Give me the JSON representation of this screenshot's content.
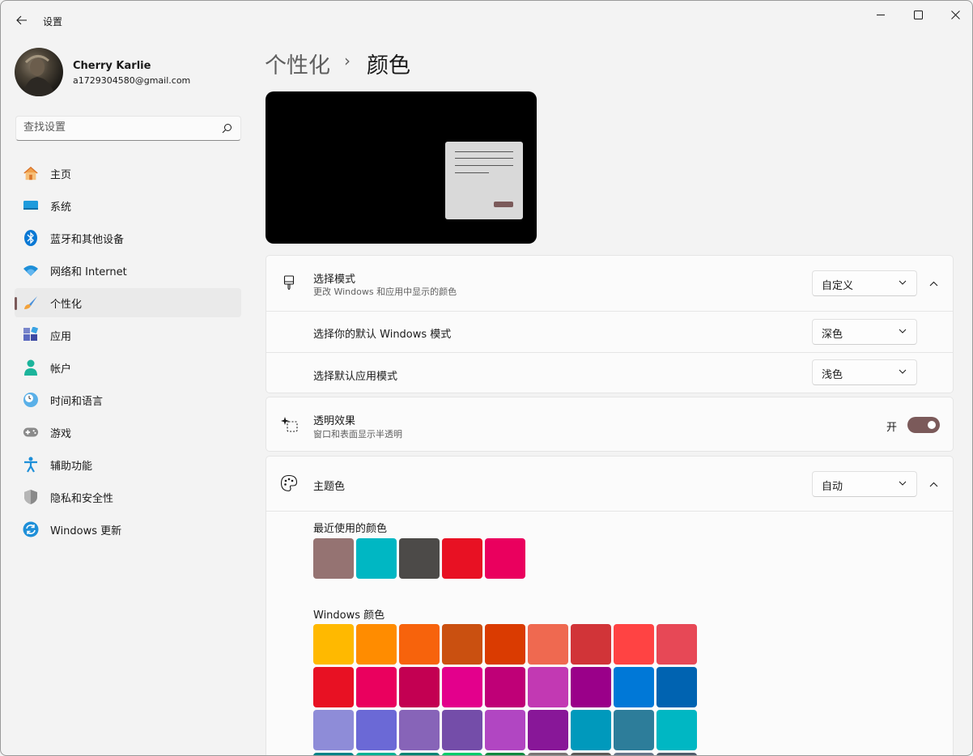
{
  "window": {
    "app_title": "设置",
    "controls": [
      "minimize-icon",
      "maximize-icon",
      "close-icon"
    ]
  },
  "user": {
    "name": "Cherry Karlie",
    "email": "a1729304580@gmail.com"
  },
  "search": {
    "placeholder": "查找设置"
  },
  "sidebar": {
    "items": [
      {
        "label": "主页",
        "icon": "home-icon"
      },
      {
        "label": "系统",
        "icon": "system-icon"
      },
      {
        "label": "蓝牙和其他设备",
        "icon": "bluetooth-icon"
      },
      {
        "label": "网络和 Internet",
        "icon": "wifi-icon"
      },
      {
        "label": "个性化",
        "icon": "brush-icon",
        "active": true
      },
      {
        "label": "应用",
        "icon": "apps-icon"
      },
      {
        "label": "帐户",
        "icon": "account-icon"
      },
      {
        "label": "时间和语言",
        "icon": "time-language-icon"
      },
      {
        "label": "游戏",
        "icon": "gamepad-icon"
      },
      {
        "label": "辅助功能",
        "icon": "accessibility-icon"
      },
      {
        "label": "隐私和安全性",
        "icon": "shield-icon"
      },
      {
        "label": "Windows 更新",
        "icon": "update-icon"
      }
    ]
  },
  "breadcrumb": {
    "parent": "个性化",
    "separator": "›",
    "current": "颜色"
  },
  "mode_card": {
    "title": "选择模式",
    "subtitle": "更改 Windows 和应用中显示的颜色",
    "value": "自定义",
    "windows_mode": {
      "label": "选择你的默认 Windows 模式",
      "value": "深色"
    },
    "app_mode": {
      "label": "选择默认应用模式",
      "value": "浅色"
    }
  },
  "transparency": {
    "title": "透明效果",
    "subtitle": "窗口和表面显示半透明",
    "state_label": "开",
    "on": true
  },
  "accent": {
    "title": "主题色",
    "value": "自动",
    "recent_label": "最近使用的颜色",
    "recent_colors": [
      "#957372",
      "#00b7c3",
      "#4c4a48",
      "#e81123",
      "#ea005e"
    ],
    "windows_label": "Windows 颜色",
    "windows_colors": [
      [
        "#ffb900",
        "#ff8c00",
        "#f7630c",
        "#ca5010",
        "#da3b01",
        "#ef6950",
        "#d13438",
        "#ff4343",
        "#e74856"
      ],
      [
        "#e81123",
        "#ea005e",
        "#c30052",
        "#e3008c",
        "#bf0077",
        "#c239b3",
        "#9a0089",
        "#0078d7",
        "#0063b1"
      ],
      [
        "#8e8cd8",
        "#6b69d6",
        "#8764b8",
        "#744da9",
        "#b146c2",
        "#881798",
        "#0099bc",
        "#2d7d9a",
        "#00b7c3"
      ],
      [
        "#038387",
        "#00b294",
        "#018574",
        "#00cc6a",
        "#10893e",
        "#7a7574",
        "#5d5a58",
        "#68768a",
        "#515c6b"
      ]
    ]
  },
  "colors": {
    "accent": "#7b5a5a",
    "background": "#f3f3f3",
    "card": "#fbfbfb"
  }
}
